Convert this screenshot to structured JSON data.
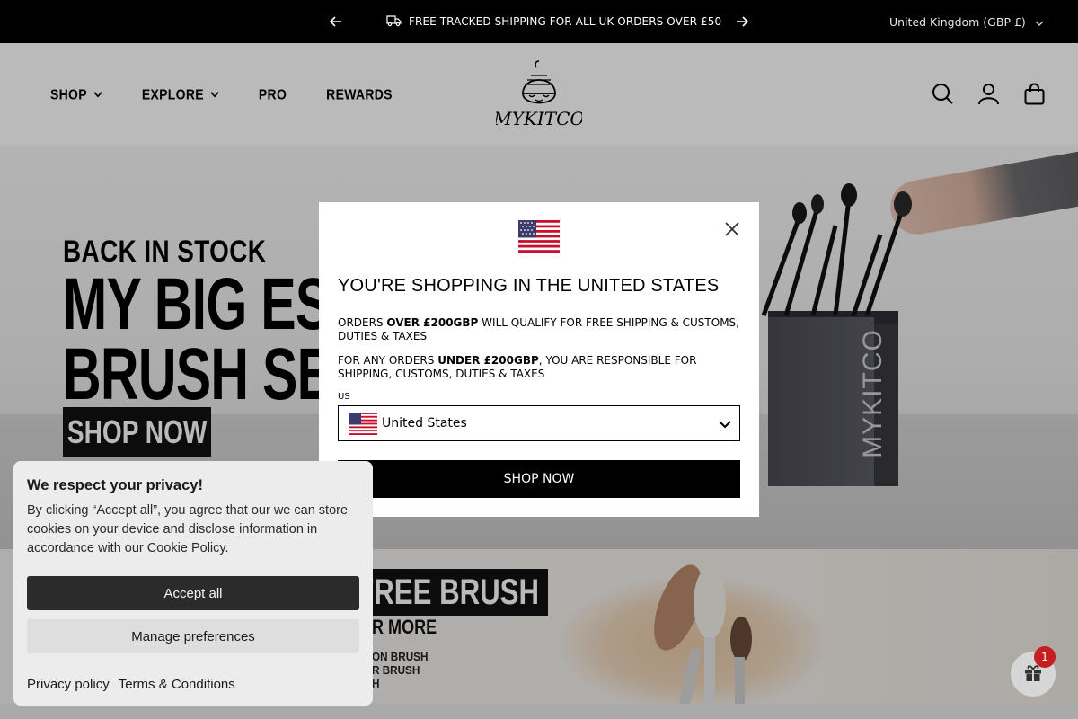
{
  "announcement": {
    "message": "FREE TRACKED SHIPPING FOR ALL UK ORDERS OVER £50",
    "currency": "United Kingdom (GBP £)"
  },
  "nav": {
    "items": [
      {
        "label": "SHOP",
        "has_dropdown": true
      },
      {
        "label": "EXPLORE",
        "has_dropdown": true
      },
      {
        "label": "PRO",
        "has_dropdown": false
      },
      {
        "label": "REWARDS",
        "has_dropdown": false
      }
    ],
    "logo_text": "MYKITCO"
  },
  "hero": {
    "line1": "BACK IN STOCK",
    "line2": "MY BIG ESS",
    "line3": "BRUSH SET",
    "button": "SHOP NOW",
    "box_label": "MYKITCO"
  },
  "banner2": {
    "headline": "FREE BRUSH",
    "subline": "R MORE",
    "list": [
      "ON BRUSH",
      "R BRUSH",
      "H"
    ]
  },
  "modal": {
    "title": "YOU'RE SHOPPING IN THE UNITED STATES",
    "p1_a": "ORDERS ",
    "p1_b": "OVER £200GBP",
    "p1_c": " WILL QUALIFY FOR FREE SHIPPING & CUSTOMS, DUTIES & TAXES",
    "p2_a": "FOR ANY ORDERS ",
    "p2_b": "UNDER £200GBP",
    "p2_c": ", YOU ARE RESPONSIBLE FOR SHIPPING, CUSTOMS, DUTIES & TAXES",
    "select_label": "US",
    "select_value": "United States",
    "button": "SHOP NOW"
  },
  "cookie": {
    "title": "We respect your privacy!",
    "text": "By clicking “Accept all”, you agree that our we can store cookies on your device and disclose information in accordance with our Cookie Policy.",
    "accept": "Accept all",
    "manage": "Manage preferences",
    "privacy": "Privacy policy",
    "terms": "Terms & Conditions"
  },
  "gift": {
    "badge_count": "1"
  },
  "colors": {
    "topbar": "#000000",
    "accent_button": "#000000",
    "badge": "#c51f1f"
  }
}
